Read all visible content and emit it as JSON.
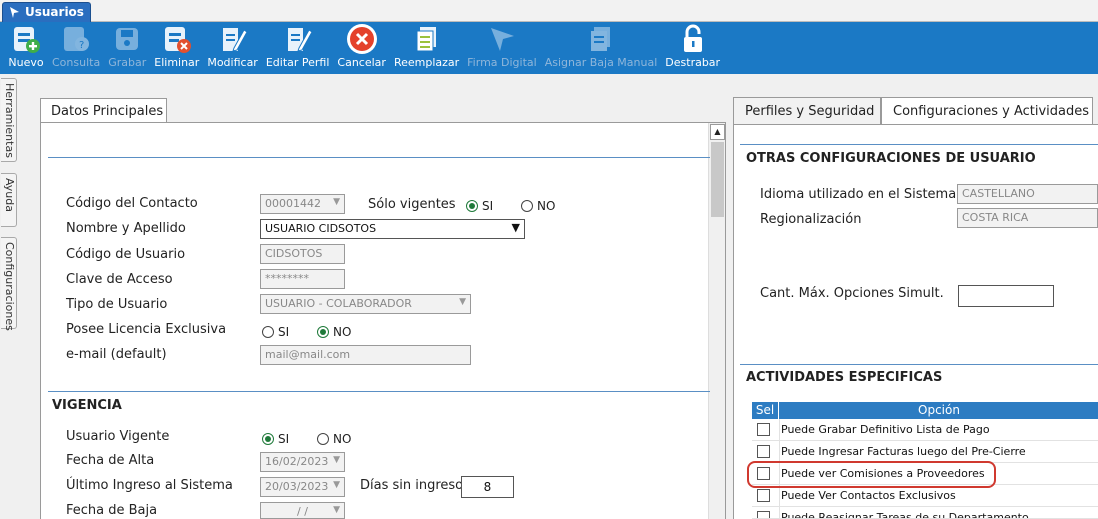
{
  "window_tab": {
    "title": "Usuarios"
  },
  "toolbar": [
    {
      "label": "Nuevo",
      "icon": "new-user-icon",
      "enabled": true
    },
    {
      "label": "Consulta",
      "icon": "query-user-icon",
      "enabled": false
    },
    {
      "label": "Grabar",
      "icon": "save-disk-icon",
      "enabled": false
    },
    {
      "label": "Eliminar",
      "icon": "delete-user-icon",
      "enabled": true
    },
    {
      "label": "Modificar",
      "icon": "edit-document-icon",
      "enabled": true
    },
    {
      "label": "Editar Perfil",
      "icon": "edit-profile-icon",
      "enabled": true
    },
    {
      "label": "Cancelar",
      "icon": "cancel-icon",
      "enabled": true
    },
    {
      "label": "Reemplazar",
      "icon": "replace-icon",
      "enabled": true
    },
    {
      "label": "Firma Digital",
      "icon": "digital-signature-icon",
      "enabled": false
    },
    {
      "label": "Asignar Baja Manual",
      "icon": "assign-removal-icon",
      "enabled": false
    },
    {
      "label": "Destrabar",
      "icon": "unlock-icon",
      "enabled": true
    }
  ],
  "side_tabs": [
    "Herramientas",
    "Ayuda",
    "Configuraciones"
  ],
  "left_tab": {
    "title": "Datos Principales"
  },
  "main": {
    "codigo_contacto": {
      "label": "Código del Contacto",
      "value": "00001442"
    },
    "solo_vigentes": {
      "label": "Sólo vigentes",
      "si": "SI",
      "no": "NO",
      "selected": "SI"
    },
    "nombre": {
      "label": "Nombre y Apellido",
      "value": "USUARIO CIDSOTOS"
    },
    "codigo_usuario": {
      "label": "Código de Usuario",
      "value": "CIDSOTOS"
    },
    "clave": {
      "label": "Clave de Acceso",
      "value": "********"
    },
    "tipo_usuario": {
      "label": "Tipo de Usuario",
      "value": "USUARIO - COLABORADOR"
    },
    "licencia": {
      "label": "Posee Licencia Exclusiva",
      "si": "SI",
      "no": "NO",
      "selected": "NO"
    },
    "email": {
      "label": "e-mail (default)",
      "placeholder": "mail@mail.com"
    }
  },
  "vigencia": {
    "title": "VIGENCIA",
    "usuario_vigente": {
      "label": "Usuario Vigente",
      "si": "SI",
      "no": "NO",
      "selected": "SI"
    },
    "fecha_alta": {
      "label": "Fecha de Alta",
      "value": "16/02/2023"
    },
    "ultimo_ingreso": {
      "label": "Último Ingreso al Sistema",
      "value": "20/03/2023"
    },
    "dias_sin_ingreso": {
      "label": "Días sin ingreso",
      "value": "8"
    },
    "fecha_baja": {
      "label": "Fecha de Baja",
      "value": "/ /"
    }
  },
  "right_tabs": [
    "Perfiles y Seguridad",
    "Configuraciones y Actividades"
  ],
  "otras": {
    "title": "OTRAS CONFIGURACIONES DE USUARIO",
    "idioma": {
      "label": "Idioma utilizado en el Sistema",
      "value": "CASTELLANO"
    },
    "regionalizacion": {
      "label": "Regionalización",
      "value": "COSTA RICA"
    },
    "cant_max": {
      "label": "Cant. Máx. Opciones Simult.",
      "value": ""
    }
  },
  "actividades": {
    "title": "ACTIVIDADES ESPECIFICAS",
    "col_sel": "Sel",
    "col_opcion": "Opción",
    "rows": [
      "Puede Grabar Definitivo Lista de Pago",
      "Puede Ingresar Facturas luego del Pre-Cierre",
      "Puede ver Comisiones a Proveedores",
      "Puede Ver Contactos Exclusivos",
      "Puede Reasignar Tareas de su Departamento"
    ]
  },
  "colors": {
    "toolbar": "#1b79c5",
    "accent": "#2d7cc2",
    "highlight": "#d0392f",
    "radio_on": "#1f7a3a"
  }
}
